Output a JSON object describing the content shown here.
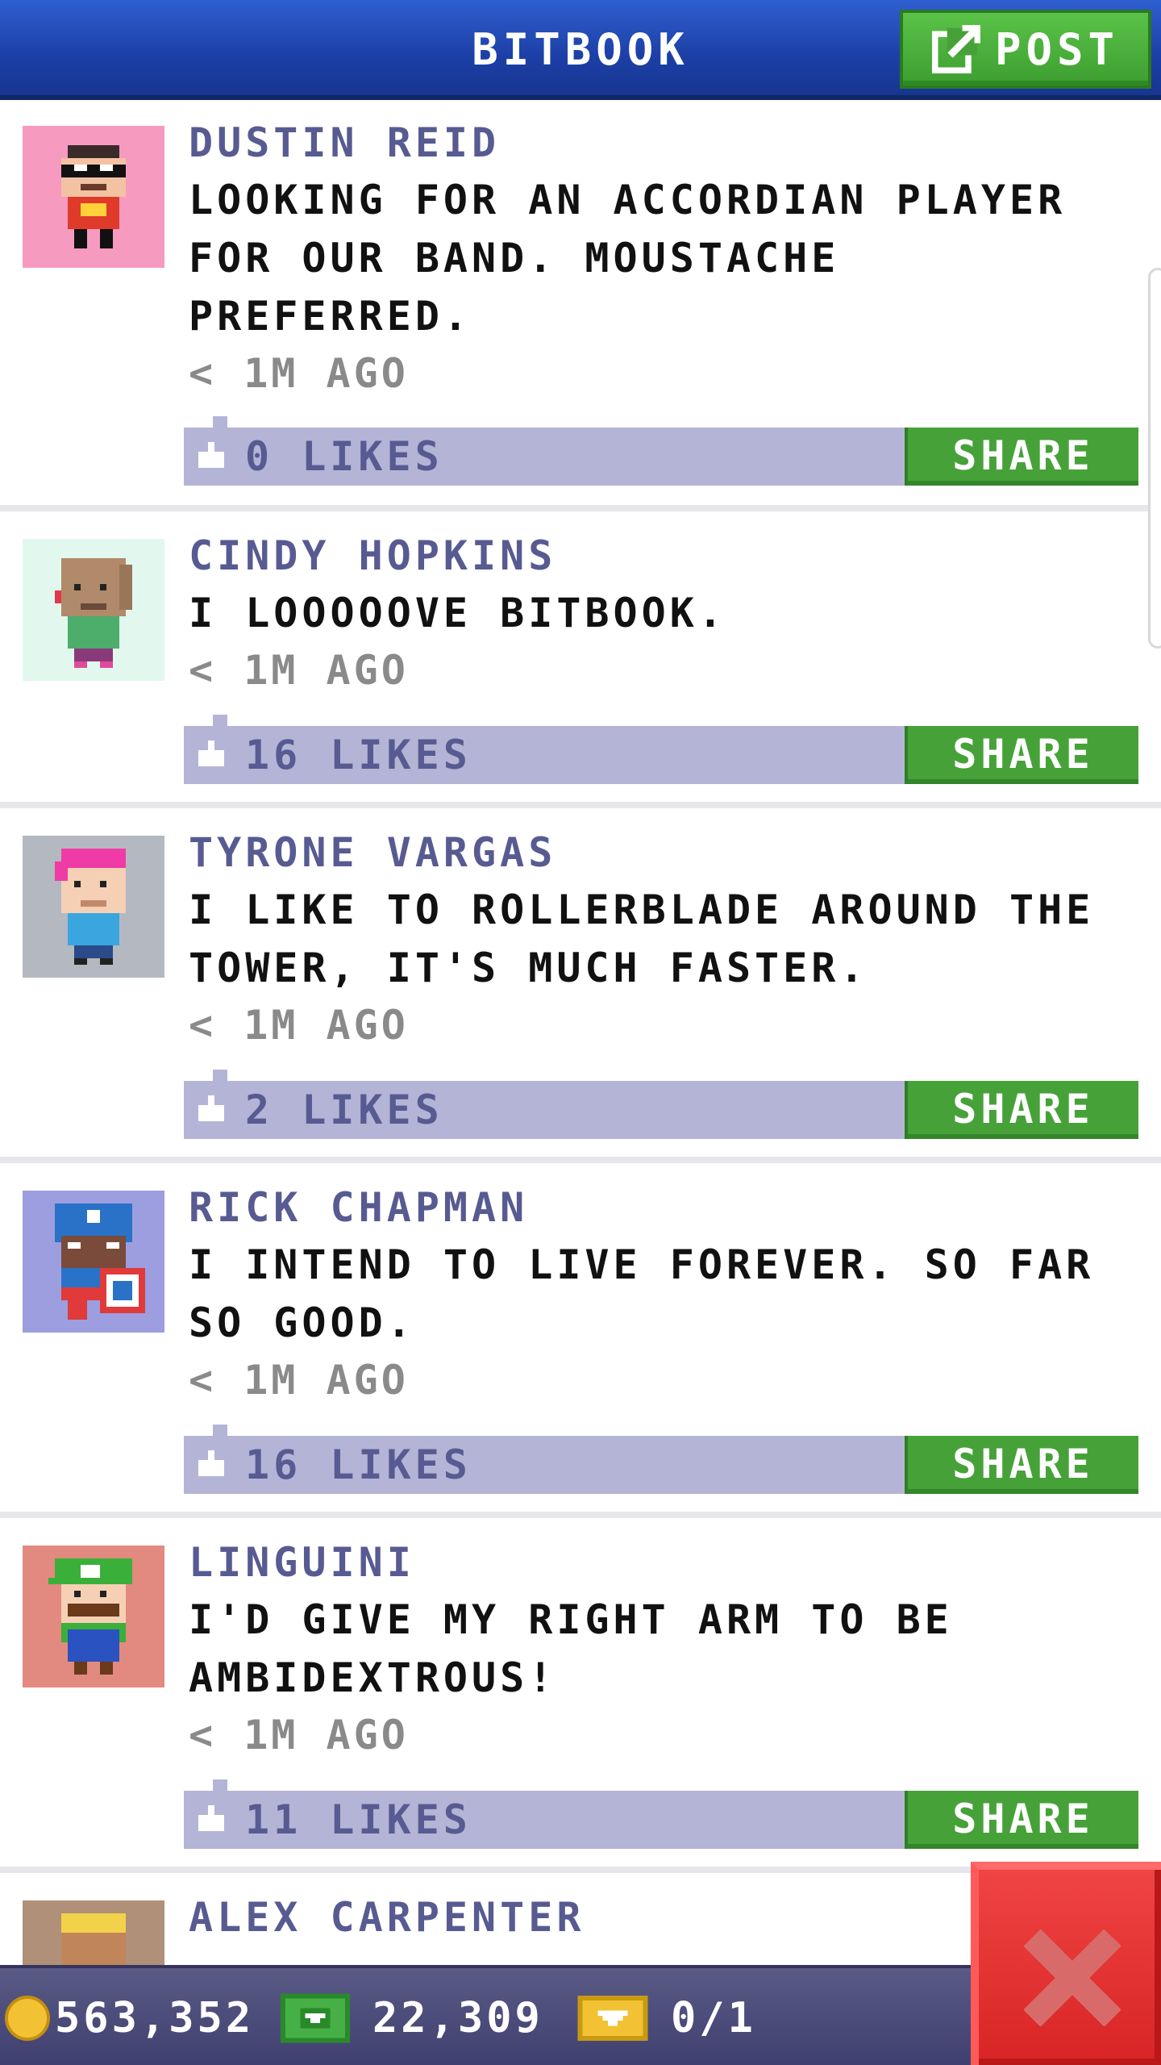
{
  "header": {
    "title": "BITBOOK",
    "post_label": "POST"
  },
  "colors": {
    "header_blue": "#1c3fa6",
    "accent_green": "#46a238",
    "likes_bar": "#b4b4d6",
    "author_text": "#575b91",
    "close_red": "#e03030"
  },
  "posts": [
    {
      "author": "DUSTIN REID",
      "message": "LOOKING FOR AN ACCORDIAN PLAYER FOR OUR BAND. MOUSTACHE PREFERRED.",
      "time": "< 1M AGO",
      "likes": "0 LIKES",
      "share_label": "SHARE",
      "avatar_bg": "#f79ac0",
      "avatar_icon": "bandit-person-avatar"
    },
    {
      "author": "CINDY HOPKINS",
      "message": "I LOOOOOVE BITBOOK.",
      "time": "< 1M AGO",
      "likes": "16 LIKES",
      "share_label": "SHARE",
      "avatar_bg": "#e2f7ee",
      "avatar_icon": "bald-person-avatar"
    },
    {
      "author": "TYRONE VARGAS",
      "message": "I LIKE TO ROLLERBLADE AROUND THE TOWER, IT'S MUCH FASTER.",
      "time": "< 1M AGO",
      "likes": "2 LIKES",
      "share_label": "SHARE",
      "avatar_bg": "#b4b8c0",
      "avatar_icon": "pink-hair-person-avatar"
    },
    {
      "author": "RICK CHAPMAN",
      "message": "I INTEND TO LIVE FOREVER. SO FAR SO GOOD.",
      "time": "< 1M AGO",
      "likes": "16 LIKES",
      "share_label": "SHARE",
      "avatar_bg": "#9c9ee0",
      "avatar_icon": "shield-hero-avatar"
    },
    {
      "author": "LINGUINI",
      "message": "I'D GIVE MY RIGHT ARM TO BE AMBIDEXTROUS!",
      "time": "< 1M AGO",
      "likes": "11 LIKES",
      "share_label": "SHARE",
      "avatar_bg": "#e28a80",
      "avatar_icon": "green-cap-plumber-avatar"
    },
    {
      "author": "ALEX CARPENTER",
      "avatar_bg": "#b09078",
      "avatar_icon": "blonde-person-avatar"
    }
  ],
  "status_bar": {
    "coins": "563,352",
    "bux": "22,309",
    "vip": "0/1"
  }
}
